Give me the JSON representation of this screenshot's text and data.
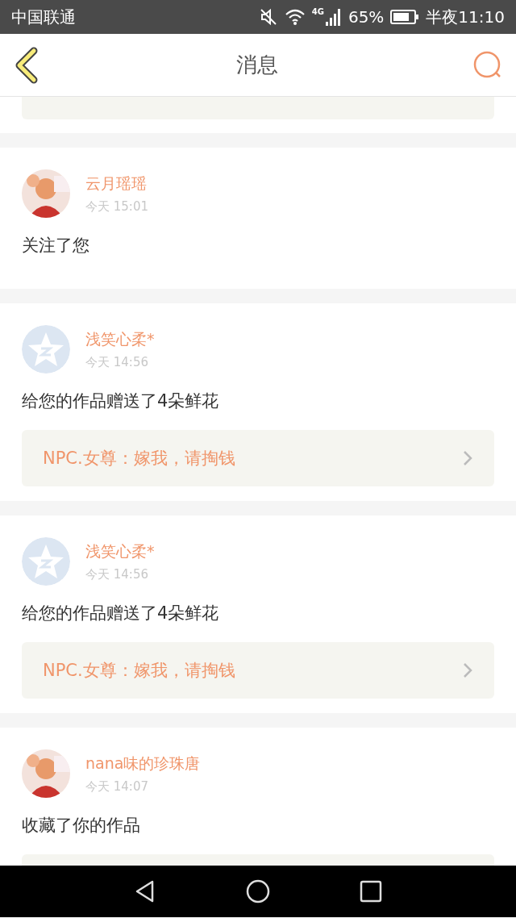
{
  "status_bar": {
    "carrier": "中国联通",
    "network": "4G",
    "battery": "65%",
    "time": "半夜11:10"
  },
  "header": {
    "title": "消息"
  },
  "messages": [
    {
      "partial": true
    },
    {
      "name": "云月瑶瑶",
      "time": "今天 15:01",
      "text": "关注了您"
    },
    {
      "name": "浅笑心柔*",
      "time": "今天 14:56",
      "avatar": {
        "kind": "default"
      },
      "text": "给您的作品赠送了4朵鲜花",
      "work": "NPC.女尊：嫁我，请掏钱"
    },
    {
      "name": "浅笑心柔*",
      "time": "今天 14:56",
      "avatar": {
        "kind": "default"
      },
      "text": "给您的作品赠送了4朵鲜花",
      "work": "NPC.女尊：嫁我，请掏钱"
    },
    {
      "name": "nana味的珍珠唐",
      "time": "今天 14:07",
      "text": "收藏了你的作品",
      "work_cut": true
    }
  ]
}
